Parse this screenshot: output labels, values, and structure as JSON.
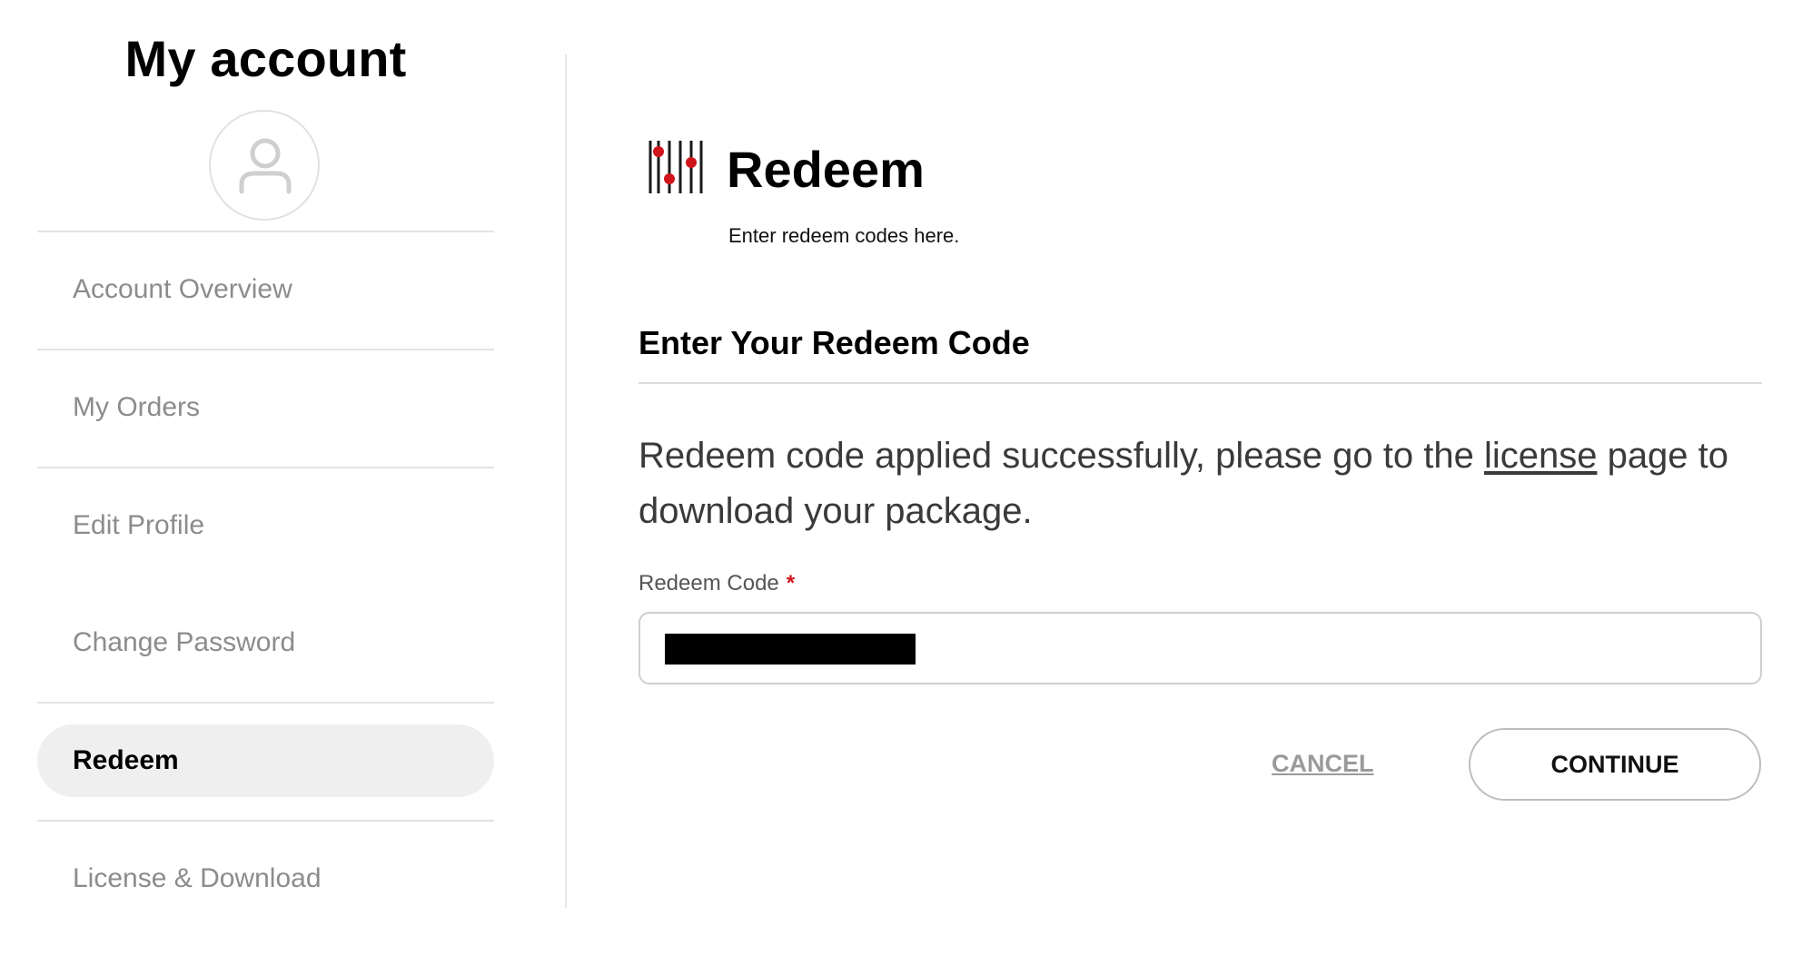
{
  "sidebar": {
    "title": "My account",
    "avatar_icon": "user-icon",
    "items": [
      {
        "label": "Account Overview",
        "active": false
      },
      {
        "label": "My Orders",
        "active": false
      },
      {
        "label": "Edit Profile",
        "active": false
      },
      {
        "label": "Change Password",
        "active": false
      },
      {
        "label": "Redeem",
        "active": true
      },
      {
        "label": "License & Download",
        "active": false
      }
    ]
  },
  "header": {
    "logo_icon": "sliders-logo-icon",
    "title": "Redeem",
    "subtitle": "Enter redeem codes here."
  },
  "form": {
    "section_title": "Enter Your Redeem Code",
    "message_before": "Redeem code applied successfully, please go to the ",
    "message_link": "license",
    "message_after": " page to download your package.",
    "field_label": "Redeem Code",
    "required_marker": "*",
    "cancel_label": "CANCEL",
    "continue_label": "CONTINUE"
  },
  "colors": {
    "accent_red": "#d1141c",
    "active_nav_bg": "#efefef",
    "muted_text": "#8c8c8c"
  }
}
